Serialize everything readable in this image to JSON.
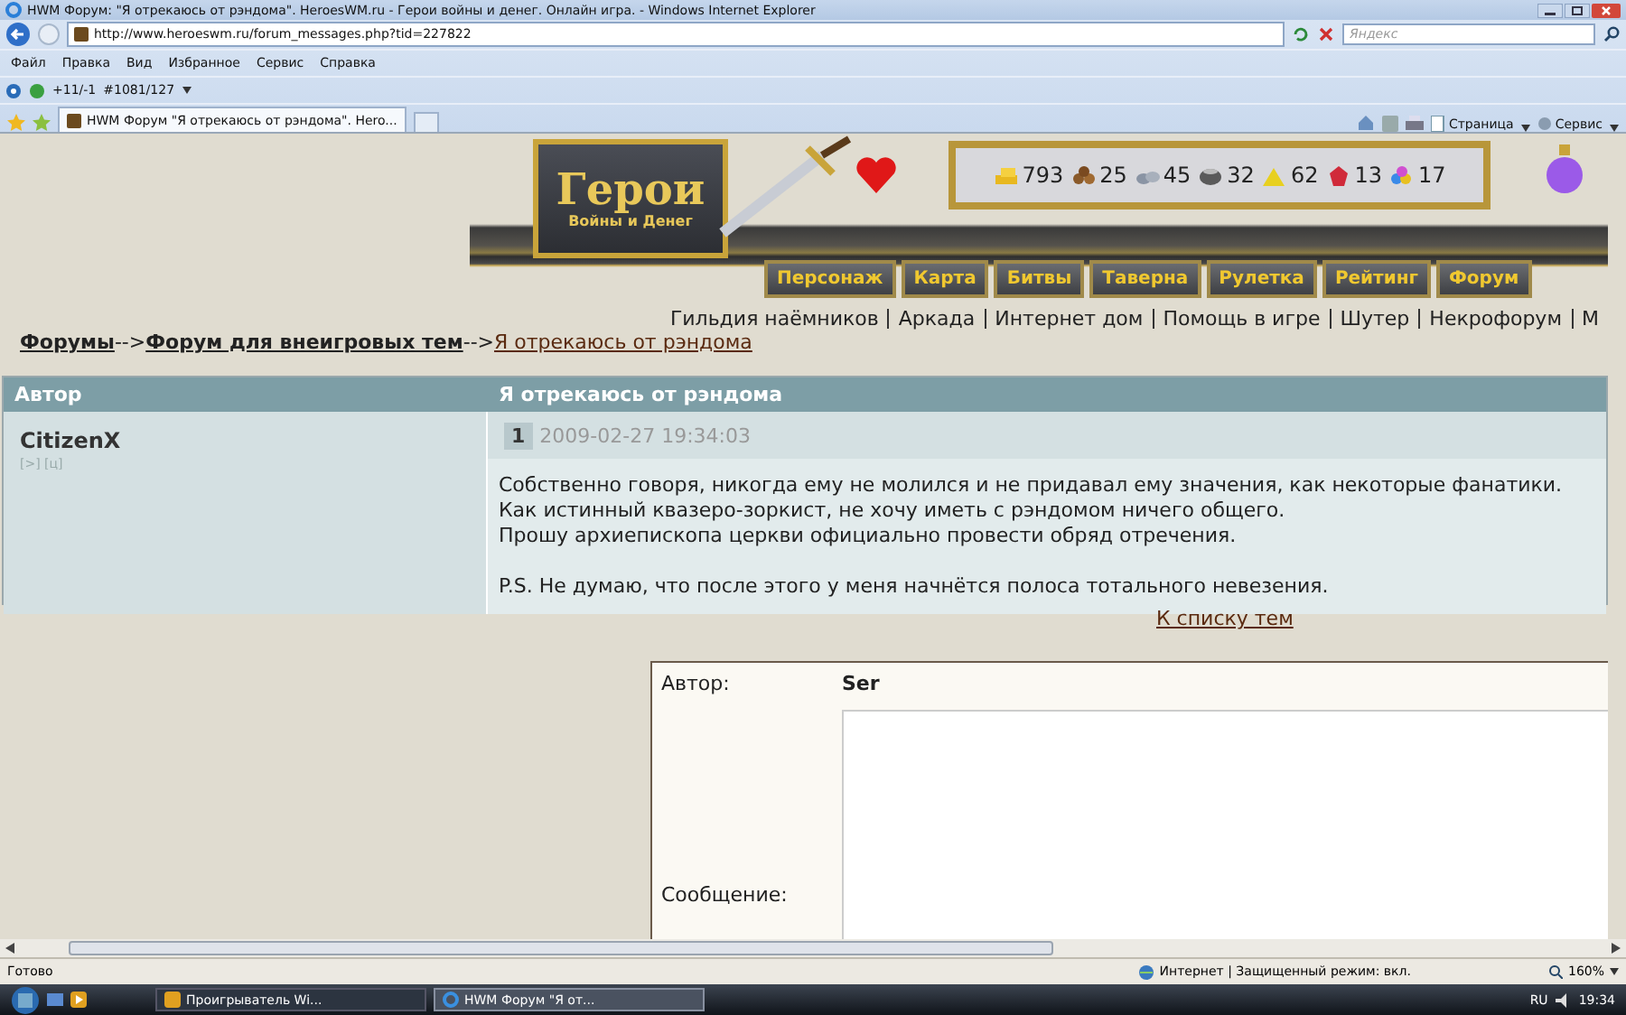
{
  "window": {
    "title": "HWM Форум: \"Я отрекаюсь от рэндома\". HeroesWM.ru - Герои войны и денег. Онлайн игра. - Windows Internet Explorer"
  },
  "address_bar": {
    "url": "http://www.heroeswm.ru/forum_messages.php?tid=227822"
  },
  "search": {
    "placeholder": "Яндекс"
  },
  "menu": [
    "Файл",
    "Правка",
    "Вид",
    "Избранное",
    "Сервис",
    "Справка"
  ],
  "toolbar": {
    "rating": "+11/-1",
    "rank": "#1081/127"
  },
  "tabs": [
    {
      "label": "HWM Форум \"Я отрекаюсь от рэндома\". Hero...",
      "selected": true
    }
  ],
  "command_bar": [
    "Страница",
    "Сервис"
  ],
  "game": {
    "logo_title": "Герои",
    "logo_subtitle": "Войны и Денег",
    "resources": [
      {
        "value": "793"
      },
      {
        "value": "25"
      },
      {
        "value": "45"
      },
      {
        "value": "32"
      },
      {
        "value": "62"
      },
      {
        "value": "13"
      },
      {
        "value": "17"
      }
    ],
    "nav": [
      "Персонаж",
      "Карта",
      "Битвы",
      "Таверна",
      "Рулетка",
      "Рейтинг",
      "Форум"
    ],
    "links": [
      "Гильдия наёмников",
      "Аркада",
      "Интернет дом",
      "Помощь в игре",
      "Шутер",
      "Некрофорум",
      "М"
    ]
  },
  "breadcrumbs": [
    {
      "label": "Форумы",
      "kind": "section"
    },
    {
      "label": "-->",
      "kind": "separator"
    },
    {
      "label": "Форум для внеигровых тем",
      "kind": "section"
    },
    {
      "label": "-->",
      "kind": "separator"
    },
    {
      "label": "Я отрекаюсь от рэндома",
      "kind": "current"
    }
  ],
  "table": {
    "columns": [
      "Автор",
      "Я отрекаюсь от рэндома"
    ],
    "post": {
      "author": "CitizenX",
      "author_links": "[>] [ц]",
      "number": "1",
      "date": "2009-02-27 19:34:03",
      "paragraphs": [
        [
          "Собственно говоря, никогда ему не молился и не придавал ему значения, как некоторые фанатики.",
          "Как истинный квазеро-зоркист, не хочу иметь с рэндомом ничего общего.",
          "Прошу архиепископа церкви официально провести обряд отречения."
        ],
        [
          "P.S. Не думаю, что после этого у меня начнётся полоса тотального невезения."
        ]
      ]
    }
  },
  "back_link": "К списку тем",
  "reply_form": {
    "author_label": "Автор:",
    "author": "Ser",
    "message_label": "Сообщение:"
  },
  "status_bar": {
    "text": "Готово",
    "zone": "Интернет | Защищенный режим: вкл.",
    "zoom": "160%"
  },
  "taskbar": {
    "items": [
      {
        "label": "Проигрыватель Wi...",
        "selected": false
      },
      {
        "label": "HWM Форум \"Я от...",
        "selected": true
      }
    ],
    "language": "RU",
    "time": "19:34"
  }
}
